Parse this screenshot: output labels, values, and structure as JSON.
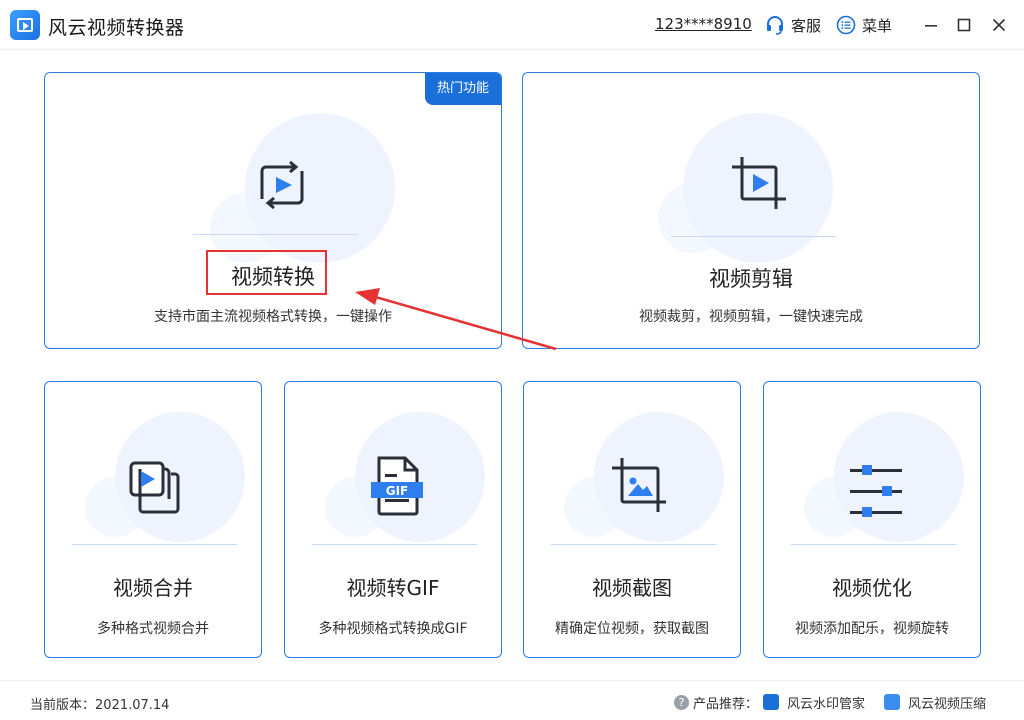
{
  "app": {
    "title": "风云视频转换器",
    "account": "123****8910",
    "service_label": "客服",
    "menu_label": "菜单"
  },
  "cards": {
    "convert": {
      "title": "视频转换",
      "desc": "支持市面主流视频格式转换，一键操作",
      "badge": "热门功能"
    },
    "edit": {
      "title": "视频剪辑",
      "desc": "视频裁剪，视频剪辑，一键快速完成"
    },
    "merge": {
      "title": "视频合并",
      "desc": "多种格式视频合并"
    },
    "gif": {
      "title": "视频转GIF",
      "desc": "多种视频格式转换成GIF",
      "icon_text": "GIF"
    },
    "screenshot": {
      "title": "视频截图",
      "desc": "精确定位视频，获取截图"
    },
    "optimize": {
      "title": "视频优化",
      "desc": "视频添加配乐，视频旋转"
    }
  },
  "footer": {
    "version_label": "当前版本：2021.07.14",
    "recommend_label": "产品推荐：",
    "help_icon_text": "?",
    "links": [
      "风云水印管家",
      "风云视频压缩"
    ]
  },
  "icons": {
    "app_logo": "app-logo-icon",
    "service": "headset-icon",
    "menu": "menu-list-icon",
    "minimize": "minimize-icon",
    "maximize": "maximize-icon",
    "close": "close-icon",
    "convert": "convert-play-icon",
    "edit": "crop-play-icon",
    "merge": "stacked-play-icon",
    "gif": "gif-file-icon",
    "screenshot": "crop-image-icon",
    "optimize": "sliders-icon",
    "watermark": "eraser-icon",
    "compress": "zip-file-icon"
  },
  "colors": {
    "accent": "#1a6fd8",
    "card_border": "#2d7be5",
    "annotation_red": "#e53232",
    "icon_dark": "#2b2f3a"
  }
}
